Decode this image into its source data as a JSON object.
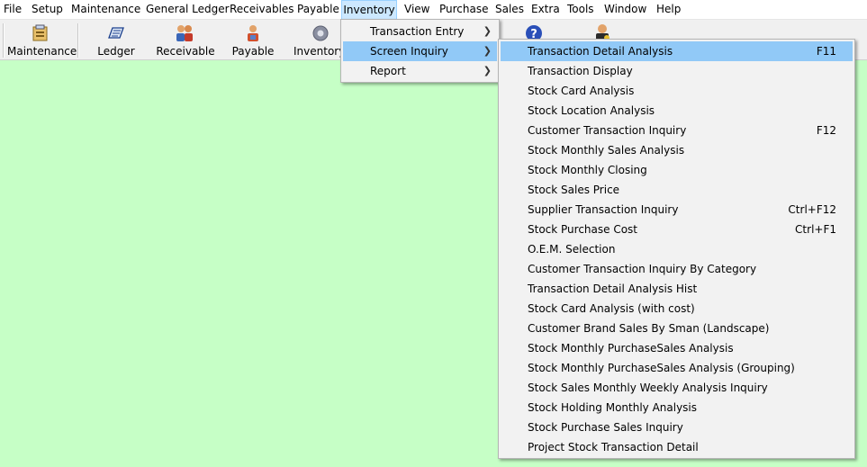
{
  "menubar": [
    "File",
    "Setup",
    "Maintenance",
    "General Ledger",
    "Receivables",
    "Payable",
    "Inventory",
    "View",
    "Purchase",
    "Sales",
    "Extra",
    "Tools",
    "Window",
    "Help"
  ],
  "toolbar": {
    "maintenance": "Maintenance",
    "ledger": "Ledger",
    "receivable": "Receivable",
    "payable": "Payable",
    "inventory": "Inventory"
  },
  "inventory_menu": [
    "Transaction Entry",
    "Screen Inquiry",
    "Report"
  ],
  "screen_inquiry": [
    {
      "label": "Transaction Detail Analysis",
      "shortcut": "F11"
    },
    {
      "label": "Transaction Display",
      "shortcut": ""
    },
    {
      "label": "Stock Card Analysis",
      "shortcut": ""
    },
    {
      "label": "Stock Location Analysis",
      "shortcut": ""
    },
    {
      "label": "Customer Transaction Inquiry",
      "shortcut": "F12"
    },
    {
      "label": "Stock Monthly Sales Analysis",
      "shortcut": ""
    },
    {
      "label": "Stock Monthly Closing",
      "shortcut": ""
    },
    {
      "label": "Stock Sales Price",
      "shortcut": ""
    },
    {
      "label": "Supplier Transaction Inquiry",
      "shortcut": "Ctrl+F12"
    },
    {
      "label": "Stock Purchase Cost",
      "shortcut": "Ctrl+F1"
    },
    {
      "label": "O.E.M. Selection",
      "shortcut": ""
    },
    {
      "label": "Customer Transaction Inquiry By Category",
      "shortcut": ""
    },
    {
      "label": "Transaction Detail Analysis Hist",
      "shortcut": ""
    },
    {
      "label": "Stock Card Analysis (with cost)",
      "shortcut": ""
    },
    {
      "label": "Customer Brand Sales By Sman (Landscape)",
      "shortcut": ""
    },
    {
      "label": "Stock Monthly PurchaseSales Analysis",
      "shortcut": ""
    },
    {
      "label": "Stock Monthly PurchaseSales Analysis (Grouping)",
      "shortcut": ""
    },
    {
      "label": "Stock Sales Monthly Weekly Analysis Inquiry",
      "shortcut": ""
    },
    {
      "label": "Stock Holding Monthly Analysis",
      "shortcut": ""
    },
    {
      "label": "Stock Purchase Sales Inquiry",
      "shortcut": ""
    },
    {
      "label": "Project Stock Transaction Detail",
      "shortcut": ""
    }
  ],
  "colors": {
    "workspace": "#c6ffc6",
    "highlight": "#91c9f7",
    "menu_bg": "#f2f2f2",
    "active_menubar": "#cce8ff"
  }
}
